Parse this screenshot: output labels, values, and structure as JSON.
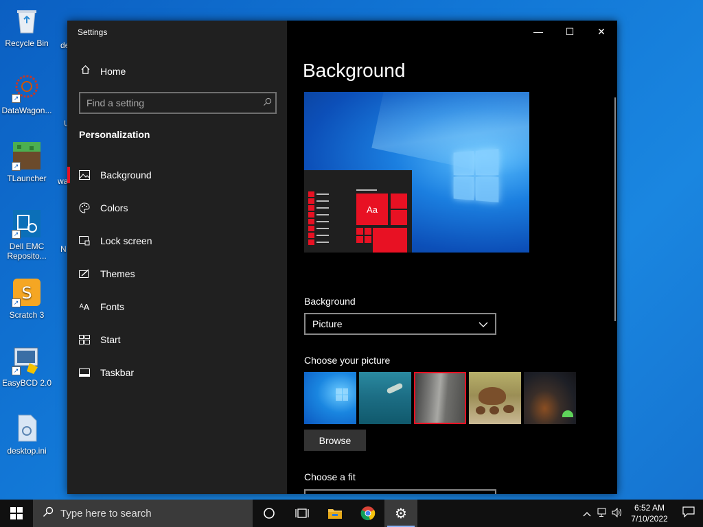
{
  "desktop": {
    "icons": [
      {
        "label": "Recycle Bin",
        "icon": "recycle-bin-icon"
      },
      {
        "label": "DataWagon...",
        "icon": "datawagon-icon"
      },
      {
        "label": "TLauncher",
        "icon": "tlauncher-icon"
      },
      {
        "label": "Dell EMC Reposito...",
        "icon": "dell-emc-icon"
      },
      {
        "label": "Scratch 3",
        "icon": "scratch-icon"
      },
      {
        "label": "EasyBCD 2.0",
        "icon": "easybcd-icon"
      },
      {
        "label": "desktop.ini",
        "icon": "file-icon"
      }
    ],
    "partial_labels": [
      "de",
      "U",
      "wa",
      "N"
    ]
  },
  "window": {
    "title": "Settings",
    "controls": {
      "minimize": "—",
      "maximize": "☐",
      "close": "✕"
    }
  },
  "sidebar": {
    "home_label": "Home",
    "search_placeholder": "Find a setting",
    "section_title": "Personalization",
    "items": [
      {
        "label": "Background",
        "icon": "picture-icon",
        "active": true
      },
      {
        "label": "Colors",
        "icon": "palette-icon"
      },
      {
        "label": "Lock screen",
        "icon": "lock-screen-icon"
      },
      {
        "label": "Themes",
        "icon": "themes-icon"
      },
      {
        "label": "Fonts",
        "icon": "fonts-icon"
      },
      {
        "label": "Start",
        "icon": "start-icon"
      },
      {
        "label": "Taskbar",
        "icon": "taskbar-icon"
      }
    ]
  },
  "main": {
    "title": "Background",
    "preview_tile_text": "Aa",
    "background_label": "Background",
    "background_value": "Picture",
    "choose_picture_label": "Choose your picture",
    "pictures": [
      "windows-light",
      "underwater-swimmer",
      "rock-cliff",
      "capybaras",
      "night-sky-tent"
    ],
    "selected_picture_index": 2,
    "browse_label": "Browse",
    "choose_fit_label": "Choose a fit"
  },
  "taskbar": {
    "search_placeholder": "Type here to search",
    "apps": [
      "cortana-icon",
      "task-view-icon",
      "file-explorer-icon",
      "chrome-icon",
      "settings-icon"
    ],
    "time": "6:52 AM",
    "date": "7/10/2022"
  },
  "colors": {
    "accent": "#e81123",
    "window_bg": "#000000",
    "sidebar_bg": "#202020",
    "taskbar_bg": "#101010"
  }
}
